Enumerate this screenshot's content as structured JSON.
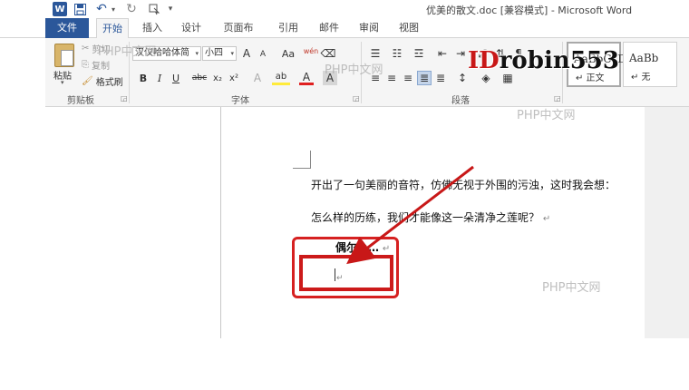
{
  "app": {
    "window_title": "优美的散文.doc [兼容模式] - Microsoft Word",
    "word_icon": "W"
  },
  "quick_access": {
    "save_icon": "save-icon",
    "undo_icon": "undo-icon",
    "redo_icon": "redo-icon",
    "touch_icon": "touch-mode-icon"
  },
  "tabs": [
    {
      "label": "文件"
    },
    {
      "label": "开始"
    },
    {
      "label": "插入"
    },
    {
      "label": "设计"
    },
    {
      "label": "页面布局"
    },
    {
      "label": "引用"
    },
    {
      "label": "邮件"
    },
    {
      "label": "审阅"
    },
    {
      "label": "视图"
    }
  ],
  "ribbon": {
    "clipboard": {
      "group_label": "剪贴板",
      "paste_label": "粘贴",
      "cut_label": "剪切",
      "copy_label": "复制",
      "painter_label": "格式刷"
    },
    "font": {
      "group_label": "字体",
      "font_name": "汉仪哈哈体简",
      "font_size": "小四",
      "bold": "B",
      "italic": "I",
      "underline": "U",
      "strike": "abc",
      "subscript": "x₂",
      "superscript": "x²",
      "grow": "A",
      "shrink": "A",
      "case": "Aa",
      "phonetic": "wén",
      "font_color": "A",
      "highlight": "ab",
      "char_shading": "A"
    },
    "paragraph": {
      "group_label": "段落"
    },
    "styles": {
      "normal_sample": "AaBbCcDd",
      "normal_name": "↵ 正文",
      "nospace_sample": "AaBb",
      "nospace_name": "↵ 无"
    }
  },
  "document": {
    "para1": "开出了一句美丽的音符，仿佛无视于外围的污浊，这时我会想：",
    "para2": "怎么样的历练，我们才能像这一朵清净之莲呢？",
    "para3": "偶尔……",
    "para_mark": "↵"
  },
  "overlay": {
    "watermark_prefix": "ID",
    "watermark_name": "robin553",
    "site_watermark": "PHP中文网"
  },
  "colors": {
    "word_blue": "#2b579a",
    "annotation_red": "#d62121"
  }
}
